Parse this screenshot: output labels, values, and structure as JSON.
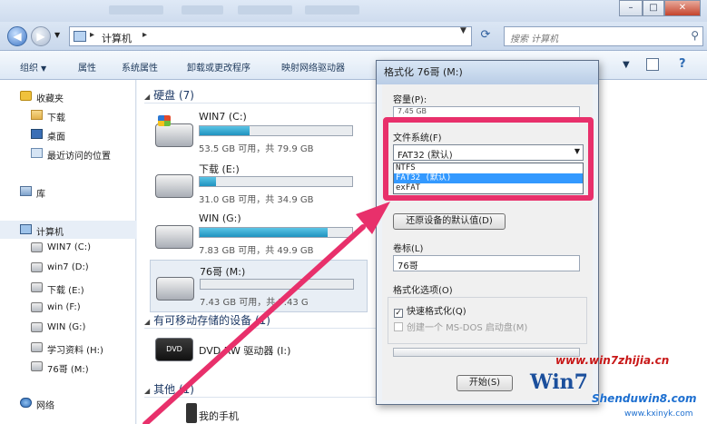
{
  "address": {
    "path": "计算机",
    "search_placeholder": "搜索 计算机"
  },
  "toolbar": {
    "organize": "组织",
    "properties": "属性",
    "system_properties": "系统属性",
    "uninstall": "卸载或更改程序",
    "map_drive": "映射网络驱动器"
  },
  "nav": {
    "favorites": "收藏夹",
    "downloads": "下载",
    "desktop": "桌面",
    "recent": "最近访问的位置",
    "libraries": "库",
    "computer": "计算机",
    "drives": [
      "WIN7 (C:)",
      "win7 (D:)",
      "下载 (E:)",
      "win (F:)",
      "WIN (G:)",
      "学习资料 (H:)",
      "76哥 (M:)"
    ],
    "network": "网络"
  },
  "content": {
    "hdd_group": "硬盘 (7)",
    "drives": [
      {
        "name": "WIN7 (C:)",
        "info": "53.5 GB 可用，共 79.9 GB",
        "used_fraction": 0.33
      },
      {
        "name": "下载 (E:)",
        "info": "31.0 GB 可用，共 34.9 GB",
        "used_fraction": 0.11
      },
      {
        "name": "WIN (G:)",
        "info": "7.83 GB 可用，共 49.9 GB",
        "used_fraction": 0.84
      },
      {
        "name": "76哥 (M:)",
        "info": "7.43 GB 可用，共 7.43 G",
        "used_fraction": 0.0
      }
    ],
    "removable_group": "有可移动存储的设备 (1)",
    "dvd_name": "DVD RW 驱动器 (I:)",
    "dvd_label": "DVD",
    "other_group": "其他 (1)",
    "phone": "我的手机"
  },
  "dialog": {
    "title": "格式化 76哥 (M:)",
    "capacity_label": "容量(P):",
    "capacity_value": "7.45 GB",
    "fs_label": "文件系统(F)",
    "fs_selected": "FAT32 (默认)",
    "fs_options": [
      "NTFS",
      "FAT32 (默认)",
      "exFAT"
    ],
    "restore_btn": "还原设备的默认值(D)",
    "volume_label": "卷标(L)",
    "volume_value": "76哥",
    "format_options_label": "格式化选项(O)",
    "quick_format": "快速格式化(Q)",
    "msdos_disk": "创建一个 MS-DOS 启动盘(M)",
    "start_btn": "开始(S)"
  },
  "watermark": {
    "site1": "www.win7zhijia.cn",
    "site2": "Shenduwin8.com",
    "site3": "www.kxinyk.com",
    "logo": "Win7"
  }
}
